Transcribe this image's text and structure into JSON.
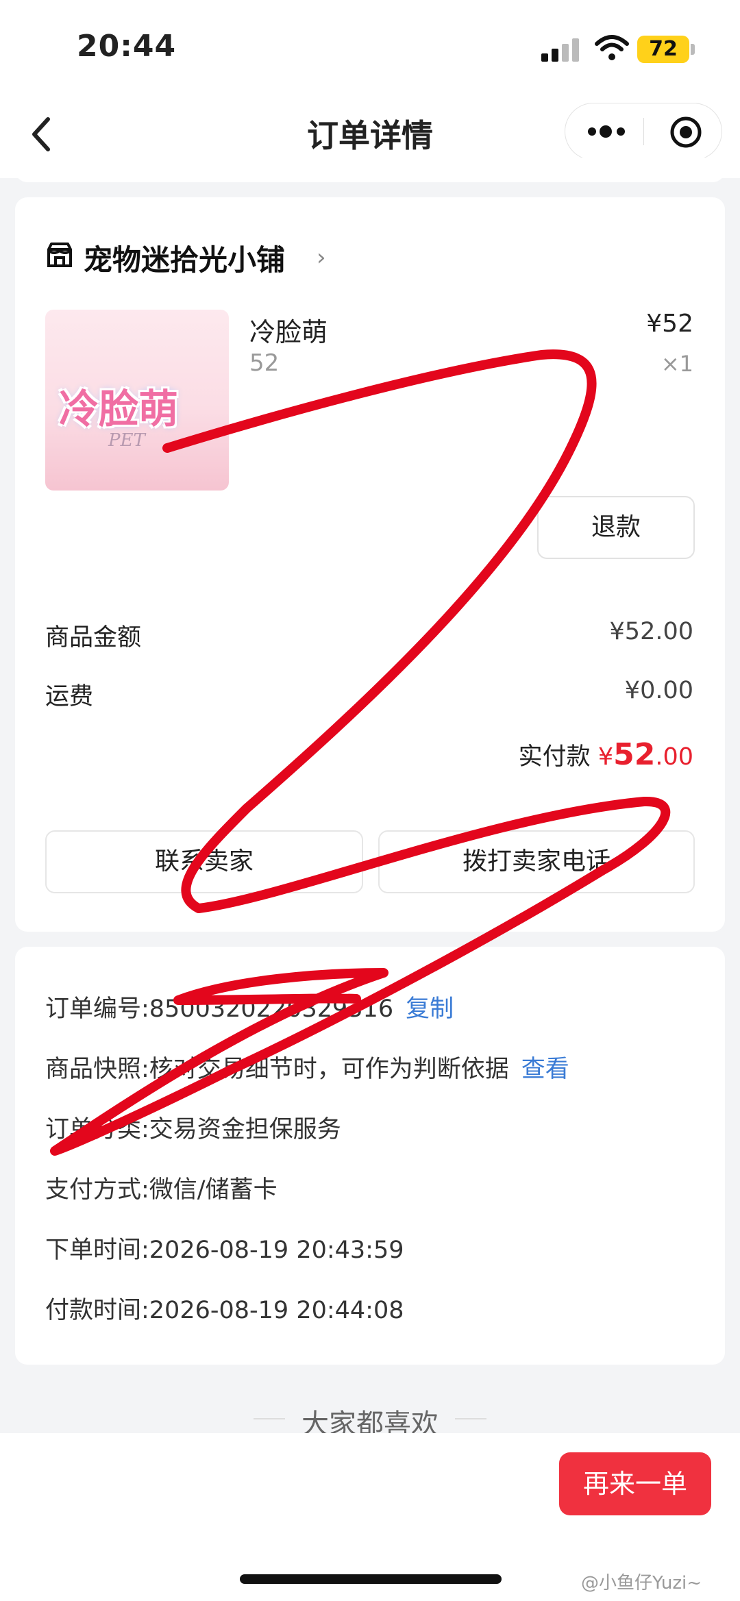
{
  "status_bar": {
    "time": "20:44",
    "battery": "72"
  },
  "nav": {
    "title": "订单详情"
  },
  "shop": {
    "name": "宠物迷拾光小铺"
  },
  "product": {
    "name": "冷脸萌",
    "spec": "52",
    "price": "¥52",
    "quantity": "×1",
    "image_text": "冷脸萌",
    "image_subtext": "PET"
  },
  "actions": {
    "refund": "退款",
    "contact_seller": "联系卖家",
    "call_seller": "拨打卖家电话"
  },
  "summary": {
    "goods_label": "商品金额",
    "goods_value": "¥52.00",
    "shipping_label": "运费",
    "shipping_value": "¥0.00",
    "paid_label": "实付款",
    "paid_currency": "¥",
    "paid_integer": "52",
    "paid_decimal": ".00"
  },
  "order_info": {
    "order_no": "订单编号:8500320220329316",
    "copy_link": "复制",
    "snapshot": "商品快照:核对交易细节时，可作为判断依据",
    "snapshot_link": "查看",
    "category": "订单分类:交易资金担保服务",
    "payment": "支付方式:微信/储蓄卡",
    "order_time": "下单时间:2026-08-19 20:43:59",
    "pay_time": "付款时间:2026-08-19 20:44:08"
  },
  "recommend": {
    "title": "大家都喜欢"
  },
  "bottom": {
    "reorder": "再来一单"
  },
  "watermark": "@小鱼仔Yuzi~",
  "colors": {
    "accent_red": "#e8202e",
    "link_blue": "#3a7bd5",
    "button_red": "#f0313f",
    "scribble_red": "#e3061c"
  }
}
